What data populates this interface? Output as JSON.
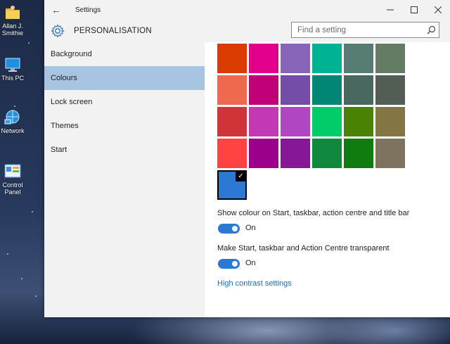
{
  "desktop": {
    "icons": [
      {
        "label": "Allan J. Smithie",
        "icon": "user-folder-icon"
      },
      {
        "label": "This PC",
        "icon": "computer-icon"
      },
      {
        "label": "Network",
        "icon": "network-icon"
      },
      {
        "label": "Control Panel",
        "icon": "control-panel-icon"
      }
    ]
  },
  "window": {
    "title": "Settings",
    "back_icon": "back-arrow-icon",
    "controls": {
      "minimize": "minimize-icon",
      "maximize": "maximize-icon",
      "close": "close-icon"
    }
  },
  "header": {
    "title": "PERSONALISATION",
    "icon": "gear-icon",
    "search_placeholder": "Find a setting",
    "search_icon": "search-icon"
  },
  "sidebar": {
    "items": [
      {
        "label": "Background",
        "active": false
      },
      {
        "label": "Colours",
        "active": true
      },
      {
        "label": "Lock screen",
        "active": false
      },
      {
        "label": "Themes",
        "active": false
      },
      {
        "label": "Start",
        "active": false
      }
    ]
  },
  "content": {
    "swatches": [
      "#da3b01",
      "#e3008c",
      "#8764b8",
      "#00b294",
      "#567c73",
      "#647c64",
      "#ef6950",
      "#bf0077",
      "#744da9",
      "#018574",
      "#486860",
      "#525e54",
      "#d13438",
      "#c239b3",
      "#b146c2",
      "#00cc6a",
      "#498205",
      "#847545",
      "#ff4343",
      "#9a0089",
      "#881798",
      "#10893e",
      "#107c10",
      "#7e735f"
    ],
    "selected_accent": {
      "color": "#2b79d3",
      "check_icon": "checkmark-icon"
    },
    "options": [
      {
        "label": "Show colour on Start, taskbar, action centre and title bar",
        "state": "On",
        "on": true
      },
      {
        "label": "Make Start, taskbar and Action Centre transparent",
        "state": "On",
        "on": true
      }
    ],
    "link": "High contrast settings"
  }
}
